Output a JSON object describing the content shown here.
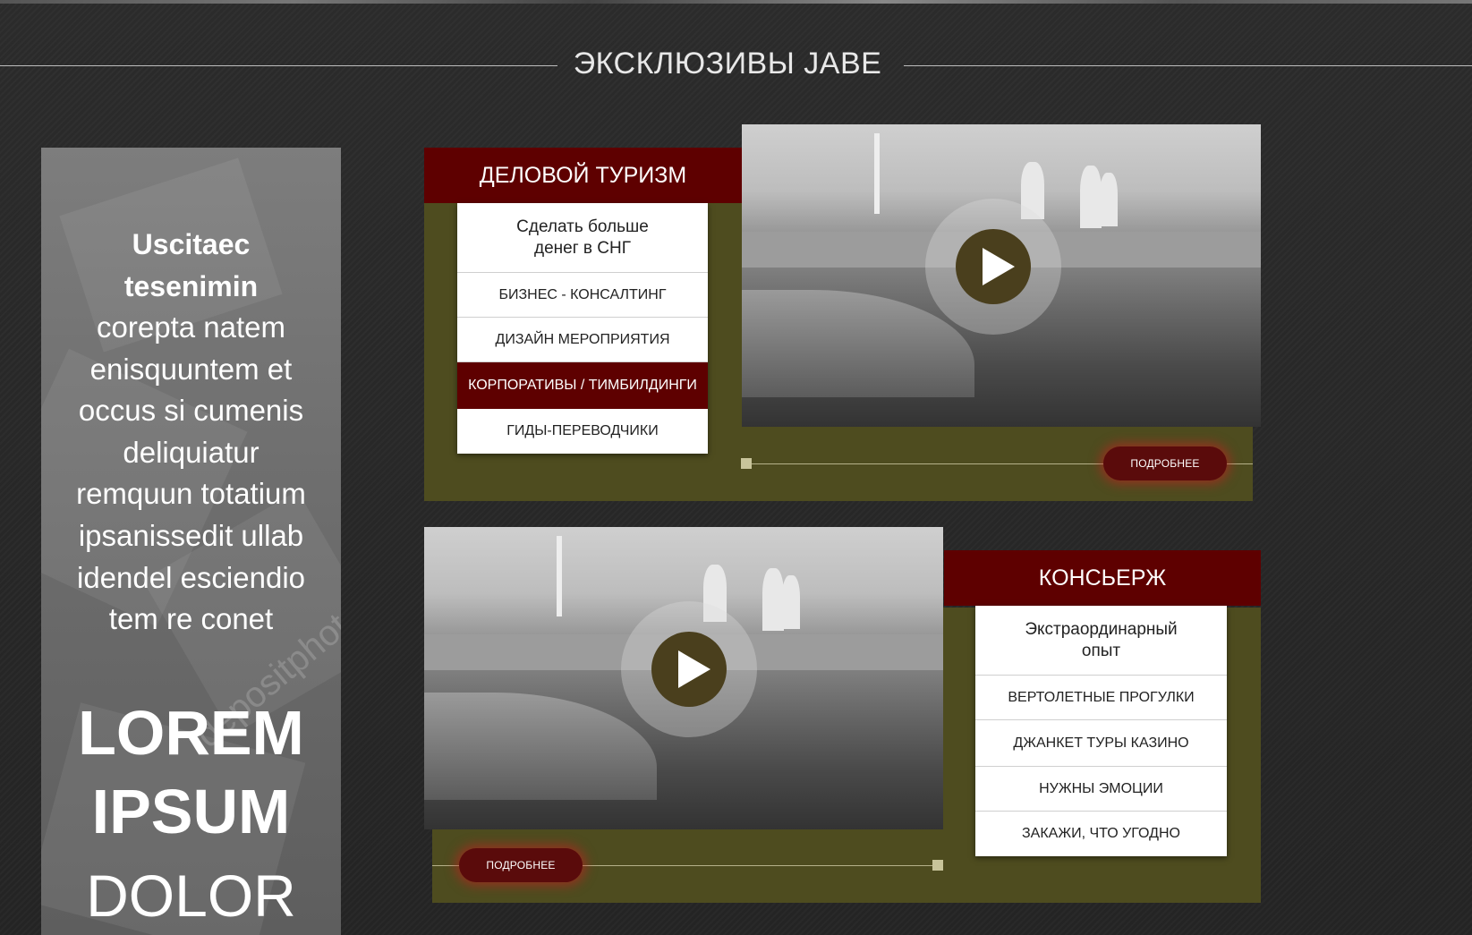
{
  "section": {
    "title": "ЭКСКЛЮЗИВЫ JABE"
  },
  "banner": {
    "bold_lines": [
      "Uscitaec",
      "tesenimin"
    ],
    "body_lines": [
      "corepta natem",
      "enisquuntem et",
      "occus si cumenis",
      "deliquiatur",
      "remquun totatium",
      "ipsanissedit ullab",
      "idendel esciendio",
      "tem re conet"
    ],
    "lorem": "LOREM",
    "ipsum": "IPSUM",
    "dolor": "DOLOR",
    "watermark": "depositphotos"
  },
  "panel1": {
    "header": "ДЕЛОВОЙ ТУРИЗМ",
    "items": [
      "Сделать больше\nденег в СНГ",
      "БИЗНЕС - КОНСАЛТИНГ",
      "ДИЗАЙН МЕРОПРИЯТИЯ",
      "КОРПОРАТИВЫ / ТИМБИЛДИНГИ",
      "ГИДЫ-ПЕРЕВОДЧИКИ"
    ],
    "active_index": 3,
    "more_label": "ПОДРОБНЕЕ"
  },
  "panel2": {
    "header": "КОНСЬЕРЖ",
    "items": [
      "Экстраординарный\nопыт",
      "ВЕРТОЛЕТНЫЕ ПРОГУЛКИ",
      "ДЖАНКЕТ ТУРЫ КАЗИНО",
      "НУЖНЫ ЭМОЦИИ",
      "ЗАКАЖИ, ЧТО УГОДНО"
    ],
    "more_label": "ПОДРОБНЕЕ"
  },
  "colors": {
    "panel_olive": "#4e4c1f",
    "header_red": "#5e0000",
    "play_brown": "#4a3f1d"
  }
}
